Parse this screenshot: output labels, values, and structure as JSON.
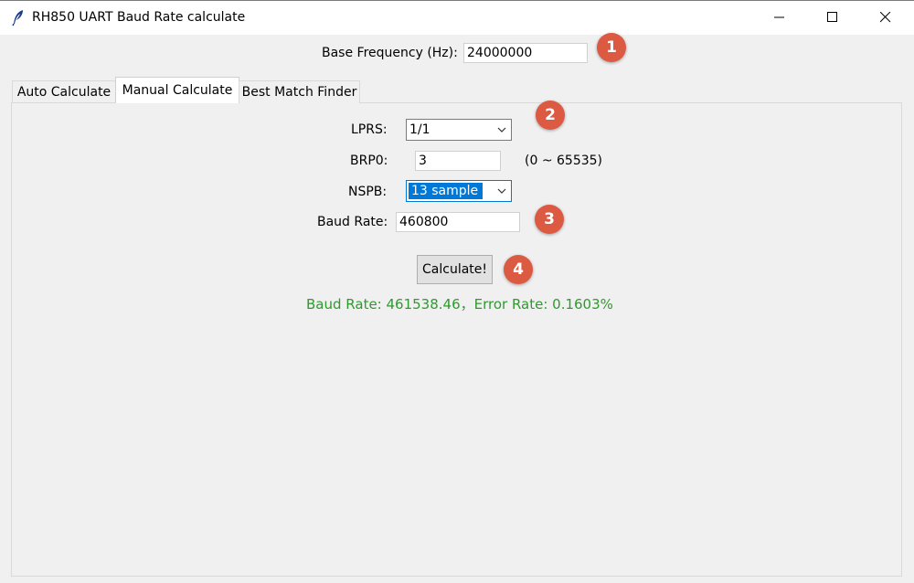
{
  "window": {
    "title": "RH850 UART Baud Rate calculate",
    "icon": "feather-icon"
  },
  "base_frequency": {
    "label": "Base Frequency (Hz):",
    "value": "24000000"
  },
  "tabs": [
    {
      "label": "Auto Calculate",
      "active": false
    },
    {
      "label": "Manual Calculate",
      "active": true
    },
    {
      "label": "Best Match Finder",
      "active": false
    }
  ],
  "manual": {
    "lprs_label": "LPRS:",
    "lprs_value": "1/1",
    "brp0_label": "BRP0:",
    "brp0_value": "3",
    "brp0_range": "(0 ~ 65535)",
    "nspb_label": "NSPB:",
    "nspb_value": "13 sample",
    "baud_label": "Baud Rate:",
    "baud_value": "460800",
    "calculate_label": "Calculate!",
    "result_text": "Baud Rate: 461538.46，Error Rate: 0.1603%",
    "result_color": "#2e9a2e"
  },
  "badges": [
    "1",
    "2",
    "3",
    "4"
  ],
  "colors": {
    "badge": "#dc5a42",
    "selection": "#0078d7"
  }
}
